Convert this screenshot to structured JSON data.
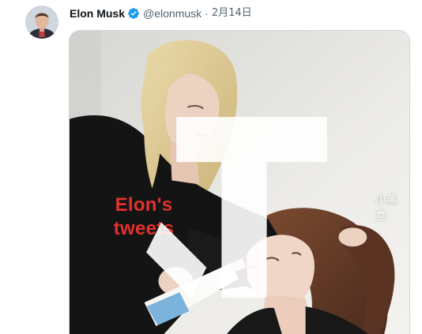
{
  "tweet": {
    "author": {
      "display_name": "Elon Musk",
      "handle": "@elonmusk",
      "verified": true,
      "avatar": "profile-photo"
    },
    "separator": "·",
    "date": "2月14日",
    "media": {
      "caption": "Elon's\ntweets",
      "watermark": "小黑盒"
    }
  },
  "colors": {
    "verified_badge": "#1d9bf0",
    "caption_text": "#e3322b",
    "secondary_text": "#536471"
  }
}
